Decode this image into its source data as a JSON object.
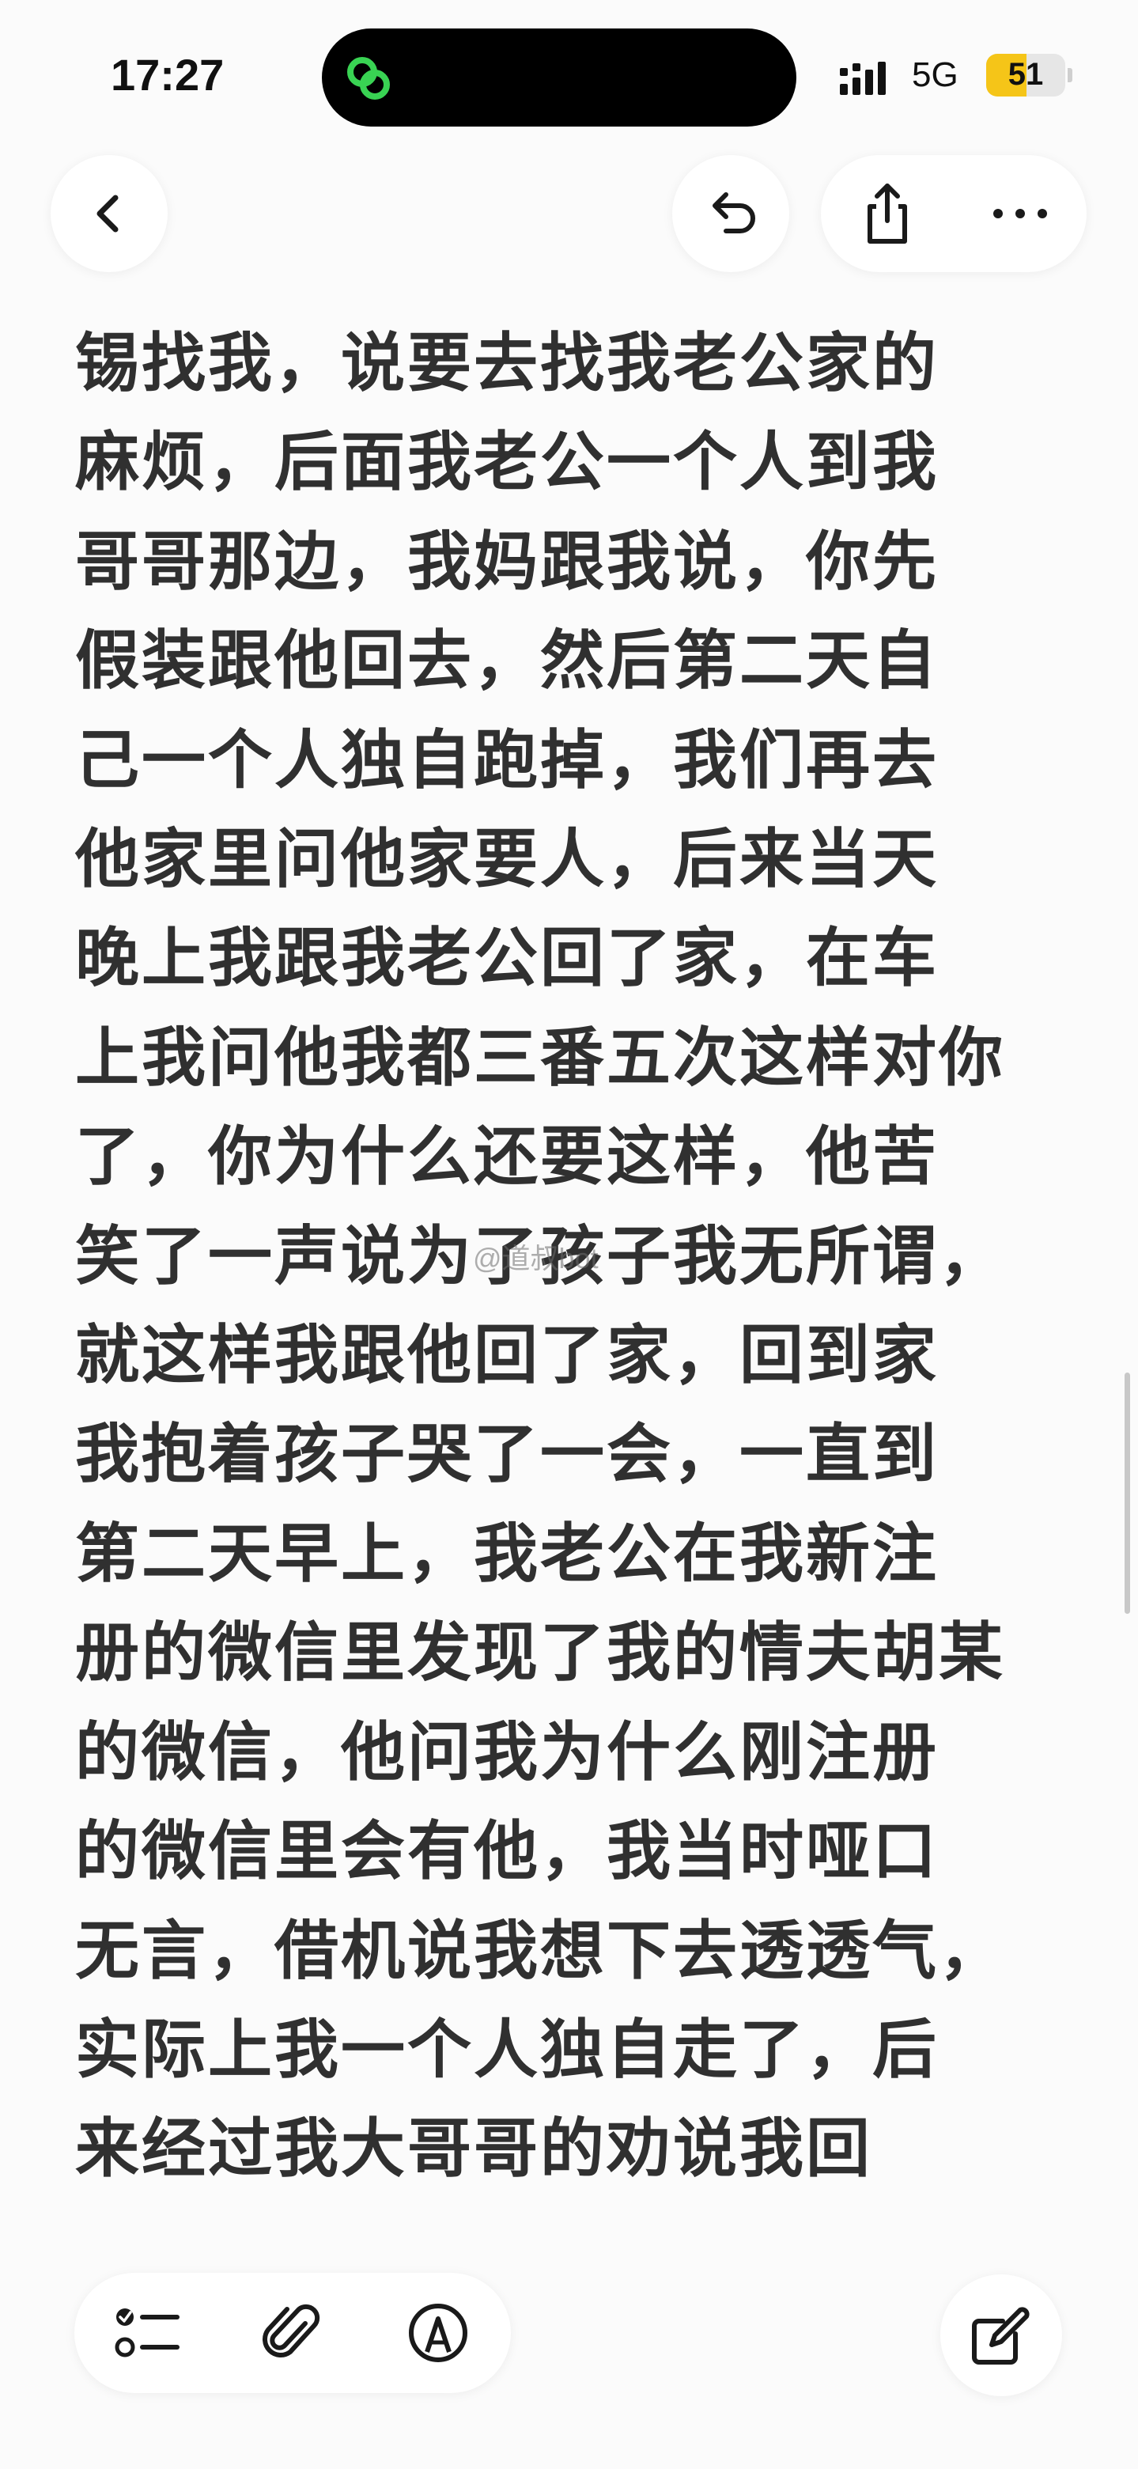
{
  "status_bar": {
    "time": "17:27",
    "network": "5G",
    "battery_level": "51",
    "battery_fraction": 0.51,
    "battery_color": "#f5c518",
    "island_app_icon": "link-rings-icon",
    "island_icon_color": "#39d353"
  },
  "toolbar": {
    "back_icon": "chevron-left-icon",
    "undo_icon": "undo-arrow-icon",
    "share_icon": "share-icon",
    "more_icon": "more-dots-icon"
  },
  "note": {
    "lines": [
      "锡找我，说要去找我老公家的",
      "麻烦，后面我老公一个人到我",
      "哥哥那边，我妈跟我说，你先",
      "假装跟他回去，然后第二天自",
      "己一个人独自跑掉，我们再去",
      "他家里问他家要人，后来当天",
      "晚上我跟我老公回了家，在车",
      "上我问他我都三番五次这样对你",
      "了，你为什么还要这样，他苦",
      "笑了一声说为了孩子我无所谓，",
      "就这样我跟他回了家，回到家",
      "我抱着孩子哭了一会，一直到",
      "第二天早上，我老公在我新注",
      "册的微信里发现了我的情夫胡某",
      "的微信，他问我为什么刚注册",
      "的微信里会有他，我当时哑口",
      "无言，借机说我想下去透透气，",
      "实际上我一个人独自走了，后",
      "来经过我大哥哥的劝说我回"
    ],
    "watermark": "@道叔bot"
  },
  "bottom_toolbar": {
    "checklist_icon": "checklist-icon",
    "attachment_icon": "paperclip-icon",
    "markup_icon": "pen-markup-icon",
    "compose_icon": "compose-icon"
  }
}
